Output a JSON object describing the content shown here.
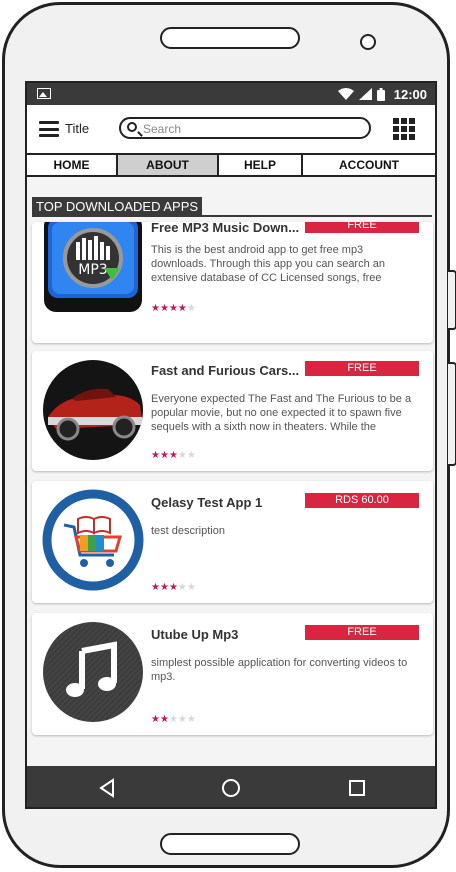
{
  "status_bar": {
    "time": "12:00",
    "icons": [
      "image-icon",
      "wifi-icon",
      "signal-icon",
      "battery-icon"
    ]
  },
  "app_bar": {
    "menu_icon": "hamburger-menu-icon",
    "title": "Title",
    "search_placeholder": "Search",
    "search_value": "",
    "apps_icon": "grid-apps-icon"
  },
  "tabs": [
    {
      "label": "HOME",
      "active": false
    },
    {
      "label": "ABOUT",
      "active": true
    },
    {
      "label": "HELP",
      "active": false
    },
    {
      "label": "ACCOUNT",
      "active": false
    }
  ],
  "section": {
    "title": "TOP DOWNLOADED APPS"
  },
  "apps": [
    {
      "name": "Free MP3 Music Down...",
      "price": "FREE",
      "description": "This is the best android app to get free mp3 downloads. Through this app you can search an extensive database of CC Licensed songs, free",
      "rating": 4,
      "max_rating": 5,
      "icon": "mp3-download-icon"
    },
    {
      "name": "Fast and Furious Cars...",
      "price": "FREE",
      "description": "Everyone expected The Fast and The Furious to be a popular movie, but no one expected it to spawn five sequels with a sixth now in theaters. While the",
      "rating": 3,
      "max_rating": 5,
      "icon": "red-muscle-car-icon"
    },
    {
      "name": "Qelasy Test App 1",
      "price": "RDS 60.00",
      "description": "test description",
      "rating": 3,
      "max_rating": 5,
      "icon": "shopping-cart-book-icon"
    },
    {
      "name": "Utube Up Mp3",
      "price": "FREE",
      "description": "simplest possible application for converting videos to mp3.",
      "rating": 2,
      "max_rating": 5,
      "icon": "music-note-icon"
    }
  ],
  "nav_bar": {
    "icons": [
      "back-icon",
      "home-icon",
      "recents-icon"
    ]
  },
  "colors": {
    "price_badge": "#d9253f",
    "star_filled": "#c2185b",
    "star_empty": "#d8d8d8",
    "status_bar": "#3a3a3a",
    "active_tab": "#cfcfcf"
  }
}
